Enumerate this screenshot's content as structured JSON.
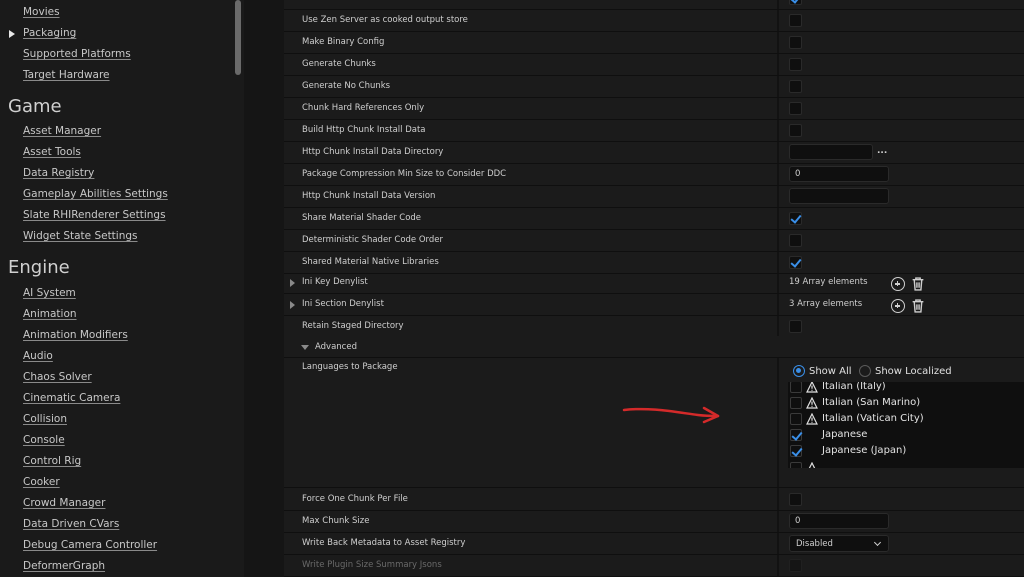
{
  "sidebar": {
    "items_top": [
      {
        "label": "Movies"
      },
      {
        "label": "Packaging"
      },
      {
        "label": "Supported Platforms"
      },
      {
        "label": "Target Hardware"
      }
    ],
    "game_title": "Game",
    "game_items": [
      {
        "label": "Asset Manager"
      },
      {
        "label": "Asset Tools"
      },
      {
        "label": "Data Registry"
      },
      {
        "label": "Gameplay Abilities Settings"
      },
      {
        "label": "Slate RHIRenderer Settings"
      },
      {
        "label": "Widget State Settings"
      }
    ],
    "engine_title": "Engine",
    "engine_items": [
      {
        "label": "AI System"
      },
      {
        "label": "Animation"
      },
      {
        "label": "Animation Modifiers"
      },
      {
        "label": "Audio"
      },
      {
        "label": "Chaos Solver"
      },
      {
        "label": "Cinematic Camera"
      },
      {
        "label": "Collision"
      },
      {
        "label": "Console"
      },
      {
        "label": "Control Rig"
      },
      {
        "label": "Cooker"
      },
      {
        "label": "Crowd Manager"
      },
      {
        "label": "Data Driven CVars"
      },
      {
        "label": "Debug Camera Controller"
      },
      {
        "label": "DeformerGraph"
      }
    ]
  },
  "rows": {
    "use_zen": "Use Zen Server as cooked output store",
    "make_binary": "Make Binary Config",
    "gen_chunks": "Generate Chunks",
    "gen_no_chunks": "Generate No Chunks",
    "chunk_hard_refs": "Chunk Hard References Only",
    "build_http": "Build Http Chunk Install Data",
    "http_dir": "Http Chunk Install Data Directory",
    "http_dir_browse": "...",
    "pkg_compress": "Package Compression Min Size to Consider DDC",
    "pkg_compress_value": "0",
    "http_version": "Http Chunk Install Data Version",
    "share_shader": "Share Material Shader Code",
    "deterministic": "Deterministic Shader Code Order",
    "shared_native": "Shared Material Native Libraries",
    "ini_key": "Ini Key Denylist",
    "ini_key_count": "19 Array elements",
    "ini_section": "Ini Section Denylist",
    "ini_section_count": "3 Array elements",
    "retain_staged": "Retain Staged Directory",
    "advanced": "Advanced",
    "languages": "Languages to Package",
    "force_one_chunk": "Force One Chunk Per File",
    "max_chunk": "Max Chunk Size",
    "max_chunk_value": "0",
    "write_back": "Write Back Metadata to Asset Registry",
    "write_back_value": "Disabled",
    "write_plugin": "Write Plugin Size Summary Jsons"
  },
  "languages": {
    "show_all": "Show All",
    "show_localized": "Show Localized",
    "items": [
      {
        "name": "Italian (Italy)"
      },
      {
        "name": "Italian (San Marino)"
      },
      {
        "name": "Italian (Vatican City)"
      },
      {
        "name": "Japanese"
      },
      {
        "name": "Japanese (Japan)"
      }
    ]
  },
  "colors": {
    "accent": "#3a8fe8",
    "annotation": "#d42a2a"
  }
}
